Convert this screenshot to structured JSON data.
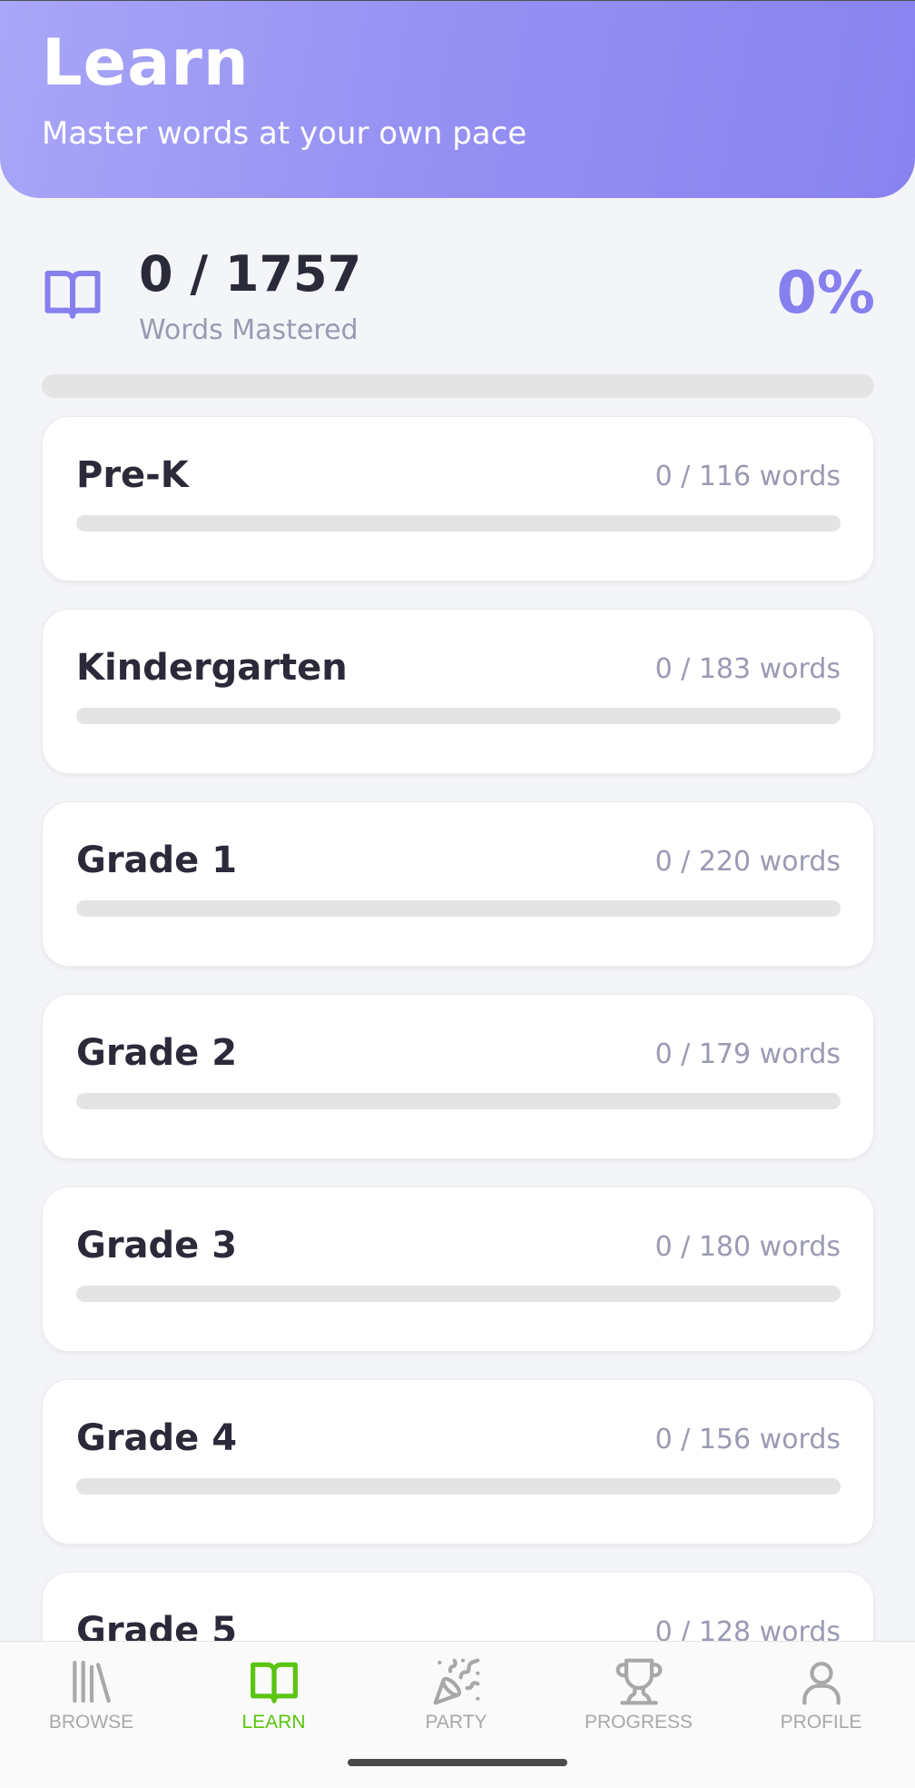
{
  "header": {
    "title": "Learn",
    "subtitle": "Master words at your own pace"
  },
  "summary": {
    "icon": "book-open-icon",
    "count": "0 / 1757",
    "label": "Words Mastered",
    "percent": "0%",
    "progress": 0
  },
  "grades": [
    {
      "name": "Pre-K",
      "words": "0 / 116 words",
      "progress": 0
    },
    {
      "name": "Kindergarten",
      "words": "0 / 183 words",
      "progress": 0
    },
    {
      "name": "Grade 1",
      "words": "0 / 220 words",
      "progress": 0
    },
    {
      "name": "Grade 2",
      "words": "0 / 179 words",
      "progress": 0
    },
    {
      "name": "Grade 3",
      "words": "0 / 180 words",
      "progress": 0
    },
    {
      "name": "Grade 4",
      "words": "0 / 156 words",
      "progress": 0
    },
    {
      "name": "Grade 5",
      "words": "0 / 128 words",
      "progress": 0
    }
  ],
  "tabs": [
    {
      "label": "BROWSE",
      "icon": "library-icon",
      "active": false
    },
    {
      "label": "LEARN",
      "icon": "book-open-icon",
      "active": true
    },
    {
      "label": "PARTY",
      "icon": "party-popper-icon",
      "active": false
    },
    {
      "label": "PROGRESS",
      "icon": "trophy-icon",
      "active": false
    },
    {
      "label": "PROFILE",
      "icon": "user-icon",
      "active": false
    }
  ],
  "colors": {
    "accent": "#8680ef",
    "active_tab": "#5ac410",
    "inactive_tab": "#a8a8a8",
    "header_start": "#a8a6f7",
    "header_end": "#8883ef"
  }
}
